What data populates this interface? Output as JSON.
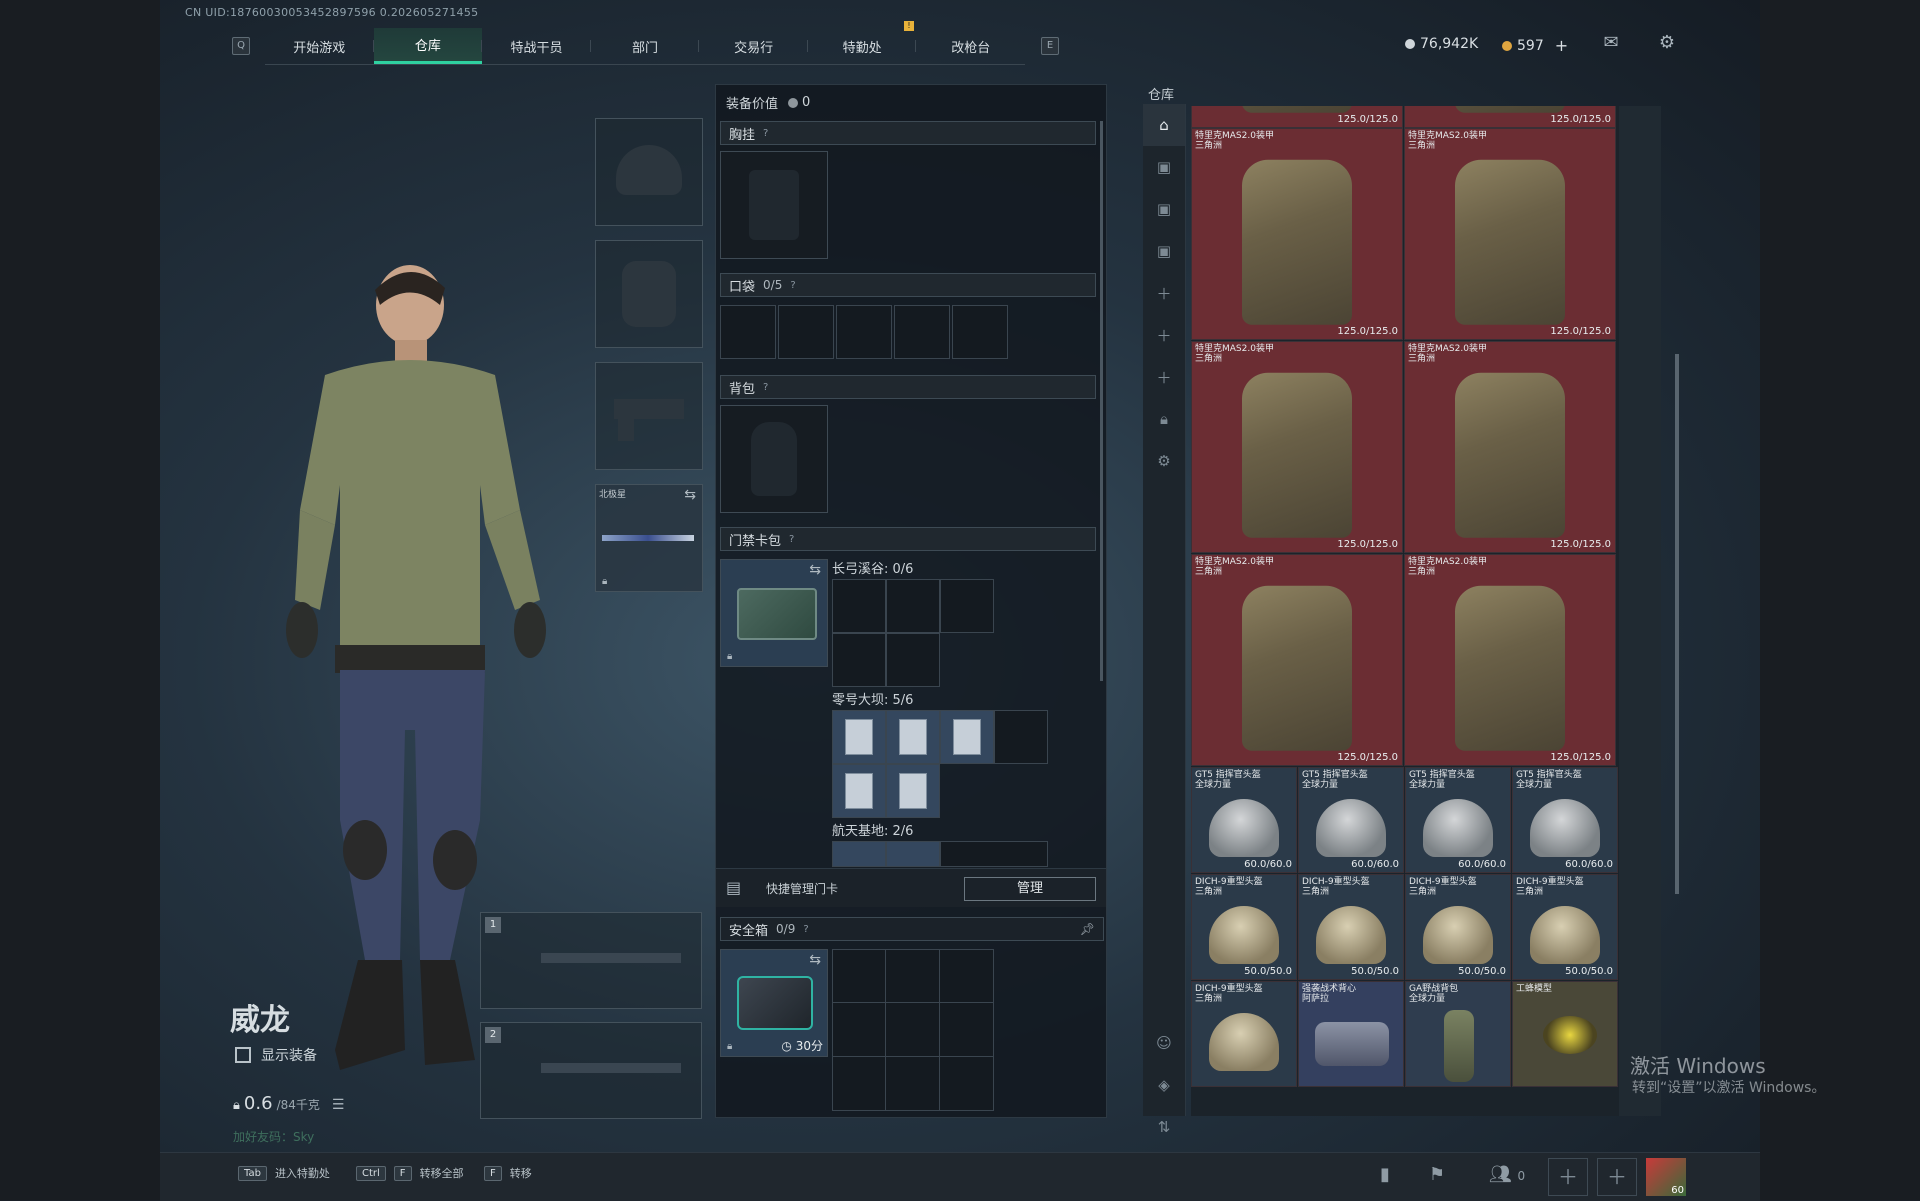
{
  "uid_text": "CN UID:18760030053452897596 0.202605271455",
  "nav": {
    "key_left": "Q",
    "key_right": "E",
    "tabs": [
      "开始游戏",
      "仓库",
      "特战干员",
      "部门",
      "交易行",
      "特勤处",
      "改枪台"
    ],
    "active_tab": "仓库",
    "notification": "!"
  },
  "currency": {
    "silver": "76,942K",
    "gold": "597",
    "add": "+",
    "silver_color": "#cfd6da",
    "gold_color": "#e0a640"
  },
  "character": {
    "name": "威龙",
    "show_gear_label": "显示装备",
    "weight_value": "0.6",
    "weight_max": "/84千克",
    "faint_text": "加好友码：Sky"
  },
  "gear_slots": {
    "melee_label": "北极星",
    "weapon1_num": "1",
    "weapon2_num": "2"
  },
  "middle": {
    "gear_value_label": "装备价值",
    "gear_value": "0",
    "chest_rig": "胸挂",
    "pockets": "口袋",
    "pockets_count": "0/5",
    "backpack": "背包",
    "keycard_wallet": "门禁卡包",
    "help": "?",
    "map1": "长弓溪谷: 0/6",
    "map2": "零号大坝: 5/6",
    "map3": "航天基地: 2/6",
    "quick_manage": "快捷管理门卡",
    "manage_button": "管理",
    "safe_box": "安全箱",
    "safe_count": "0/9",
    "safe_timer": "30分"
  },
  "warehouse": {
    "title": "仓库",
    "armor_name": "特里克MAS2.0装甲",
    "armor_sub": "三角洲",
    "armor_dur": "125.0/125.0",
    "gt5_name": "GT5 指挥官头盔",
    "gt5_sub": "全球力量",
    "gt5_dur": "60.0/60.0",
    "dich_name": "DICH-9重型头盔",
    "dich_sub": "三角洲",
    "dich_dur": "50.0/50.0",
    "bottom_items": [
      {
        "name": "DICH-9重型头盔",
        "sub": "三角洲"
      },
      {
        "name": "强袭战术背心",
        "sub": "阿萨拉"
      },
      {
        "name": "GA野战背包",
        "sub": "全球力量"
      },
      {
        "name": "工蜂模型",
        "sub": ""
      }
    ]
  },
  "watermark": {
    "line1": "激活 Windows",
    "line2": "转到“设置”以激活 Windows。"
  },
  "bottom_hints": [
    {
      "key": "Tab",
      "key2": "",
      "label": "进入特勤处"
    },
    {
      "key": "Ctrl",
      "key2": "F",
      "label": "转移全部"
    },
    {
      "key": "F",
      "key2": "",
      "label": "转移"
    }
  ],
  "friends_count": "0",
  "avatar_level": "60",
  "icons": {
    "mail": "mail-icon",
    "settings": "gear-icon"
  }
}
